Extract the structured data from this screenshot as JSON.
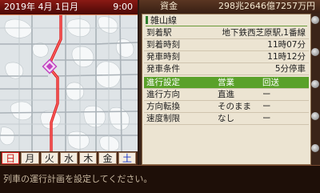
{
  "datebar": {
    "date": "2019年 4月 1日月",
    "time": "9:00"
  },
  "weekdays": [
    "日",
    "月",
    "火",
    "水",
    "木",
    "金",
    "土"
  ],
  "funds": {
    "label": "資金",
    "value": "298兆2646億7257万円"
  },
  "route": {
    "line_name": "雑山線",
    "rows": [
      {
        "key": "到着駅",
        "value": "地下鉄西芝原駅,1番線"
      },
      {
        "key": "到着時刻",
        "value": "11時07分"
      },
      {
        "key": "発車時刻",
        "value": "11時12分"
      },
      {
        "key": "発車条件",
        "value": "5分停車"
      }
    ],
    "settings_header": {
      "c1": "進行設定",
      "c2": "営業",
      "c3": "回送"
    },
    "settings": [
      {
        "key": "進行方向",
        "c2": "直進",
        "c3": "ー"
      },
      {
        "key": "方向転換",
        "c2": "そのまま",
        "c3": "ー"
      },
      {
        "key": "速度制限",
        "c2": "なし",
        "c3": "ー"
      }
    ]
  },
  "message": "列車の運行計画を設定してください。",
  "colors": {
    "rail": "#e02020",
    "selected_row": "#5aa12a",
    "station_marker": "#c040c0"
  }
}
